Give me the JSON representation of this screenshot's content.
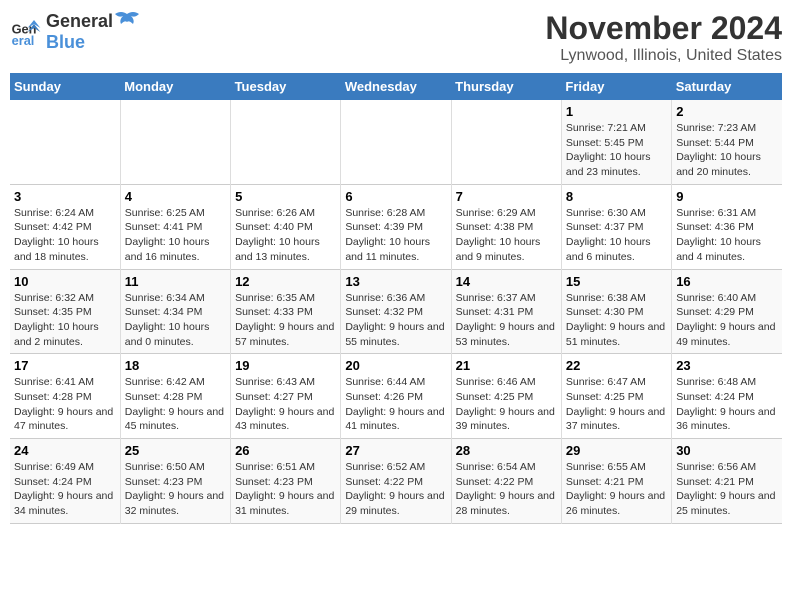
{
  "logo": {
    "general": "General",
    "blue": "Blue"
  },
  "title": "November 2024",
  "subtitle": "Lynwood, Illinois, United States",
  "days_of_week": [
    "Sunday",
    "Monday",
    "Tuesday",
    "Wednesday",
    "Thursday",
    "Friday",
    "Saturday"
  ],
  "weeks": [
    [
      {
        "day": "",
        "info": ""
      },
      {
        "day": "",
        "info": ""
      },
      {
        "day": "",
        "info": ""
      },
      {
        "day": "",
        "info": ""
      },
      {
        "day": "",
        "info": ""
      },
      {
        "day": "1",
        "info": "Sunrise: 7:21 AM\nSunset: 5:45 PM\nDaylight: 10 hours and 23 minutes."
      },
      {
        "day": "2",
        "info": "Sunrise: 7:23 AM\nSunset: 5:44 PM\nDaylight: 10 hours and 20 minutes."
      }
    ],
    [
      {
        "day": "3",
        "info": "Sunrise: 6:24 AM\nSunset: 4:42 PM\nDaylight: 10 hours and 18 minutes."
      },
      {
        "day": "4",
        "info": "Sunrise: 6:25 AM\nSunset: 4:41 PM\nDaylight: 10 hours and 16 minutes."
      },
      {
        "day": "5",
        "info": "Sunrise: 6:26 AM\nSunset: 4:40 PM\nDaylight: 10 hours and 13 minutes."
      },
      {
        "day": "6",
        "info": "Sunrise: 6:28 AM\nSunset: 4:39 PM\nDaylight: 10 hours and 11 minutes."
      },
      {
        "day": "7",
        "info": "Sunrise: 6:29 AM\nSunset: 4:38 PM\nDaylight: 10 hours and 9 minutes."
      },
      {
        "day": "8",
        "info": "Sunrise: 6:30 AM\nSunset: 4:37 PM\nDaylight: 10 hours and 6 minutes."
      },
      {
        "day": "9",
        "info": "Sunrise: 6:31 AM\nSunset: 4:36 PM\nDaylight: 10 hours and 4 minutes."
      }
    ],
    [
      {
        "day": "10",
        "info": "Sunrise: 6:32 AM\nSunset: 4:35 PM\nDaylight: 10 hours and 2 minutes."
      },
      {
        "day": "11",
        "info": "Sunrise: 6:34 AM\nSunset: 4:34 PM\nDaylight: 10 hours and 0 minutes."
      },
      {
        "day": "12",
        "info": "Sunrise: 6:35 AM\nSunset: 4:33 PM\nDaylight: 9 hours and 57 minutes."
      },
      {
        "day": "13",
        "info": "Sunrise: 6:36 AM\nSunset: 4:32 PM\nDaylight: 9 hours and 55 minutes."
      },
      {
        "day": "14",
        "info": "Sunrise: 6:37 AM\nSunset: 4:31 PM\nDaylight: 9 hours and 53 minutes."
      },
      {
        "day": "15",
        "info": "Sunrise: 6:38 AM\nSunset: 4:30 PM\nDaylight: 9 hours and 51 minutes."
      },
      {
        "day": "16",
        "info": "Sunrise: 6:40 AM\nSunset: 4:29 PM\nDaylight: 9 hours and 49 minutes."
      }
    ],
    [
      {
        "day": "17",
        "info": "Sunrise: 6:41 AM\nSunset: 4:28 PM\nDaylight: 9 hours and 47 minutes."
      },
      {
        "day": "18",
        "info": "Sunrise: 6:42 AM\nSunset: 4:28 PM\nDaylight: 9 hours and 45 minutes."
      },
      {
        "day": "19",
        "info": "Sunrise: 6:43 AM\nSunset: 4:27 PM\nDaylight: 9 hours and 43 minutes."
      },
      {
        "day": "20",
        "info": "Sunrise: 6:44 AM\nSunset: 4:26 PM\nDaylight: 9 hours and 41 minutes."
      },
      {
        "day": "21",
        "info": "Sunrise: 6:46 AM\nSunset: 4:25 PM\nDaylight: 9 hours and 39 minutes."
      },
      {
        "day": "22",
        "info": "Sunrise: 6:47 AM\nSunset: 4:25 PM\nDaylight: 9 hours and 37 minutes."
      },
      {
        "day": "23",
        "info": "Sunrise: 6:48 AM\nSunset: 4:24 PM\nDaylight: 9 hours and 36 minutes."
      }
    ],
    [
      {
        "day": "24",
        "info": "Sunrise: 6:49 AM\nSunset: 4:24 PM\nDaylight: 9 hours and 34 minutes."
      },
      {
        "day": "25",
        "info": "Sunrise: 6:50 AM\nSunset: 4:23 PM\nDaylight: 9 hours and 32 minutes."
      },
      {
        "day": "26",
        "info": "Sunrise: 6:51 AM\nSunset: 4:23 PM\nDaylight: 9 hours and 31 minutes."
      },
      {
        "day": "27",
        "info": "Sunrise: 6:52 AM\nSunset: 4:22 PM\nDaylight: 9 hours and 29 minutes."
      },
      {
        "day": "28",
        "info": "Sunrise: 6:54 AM\nSunset: 4:22 PM\nDaylight: 9 hours and 28 minutes."
      },
      {
        "day": "29",
        "info": "Sunrise: 6:55 AM\nSunset: 4:21 PM\nDaylight: 9 hours and 26 minutes."
      },
      {
        "day": "30",
        "info": "Sunrise: 6:56 AM\nSunset: 4:21 PM\nDaylight: 9 hours and 25 minutes."
      }
    ]
  ]
}
